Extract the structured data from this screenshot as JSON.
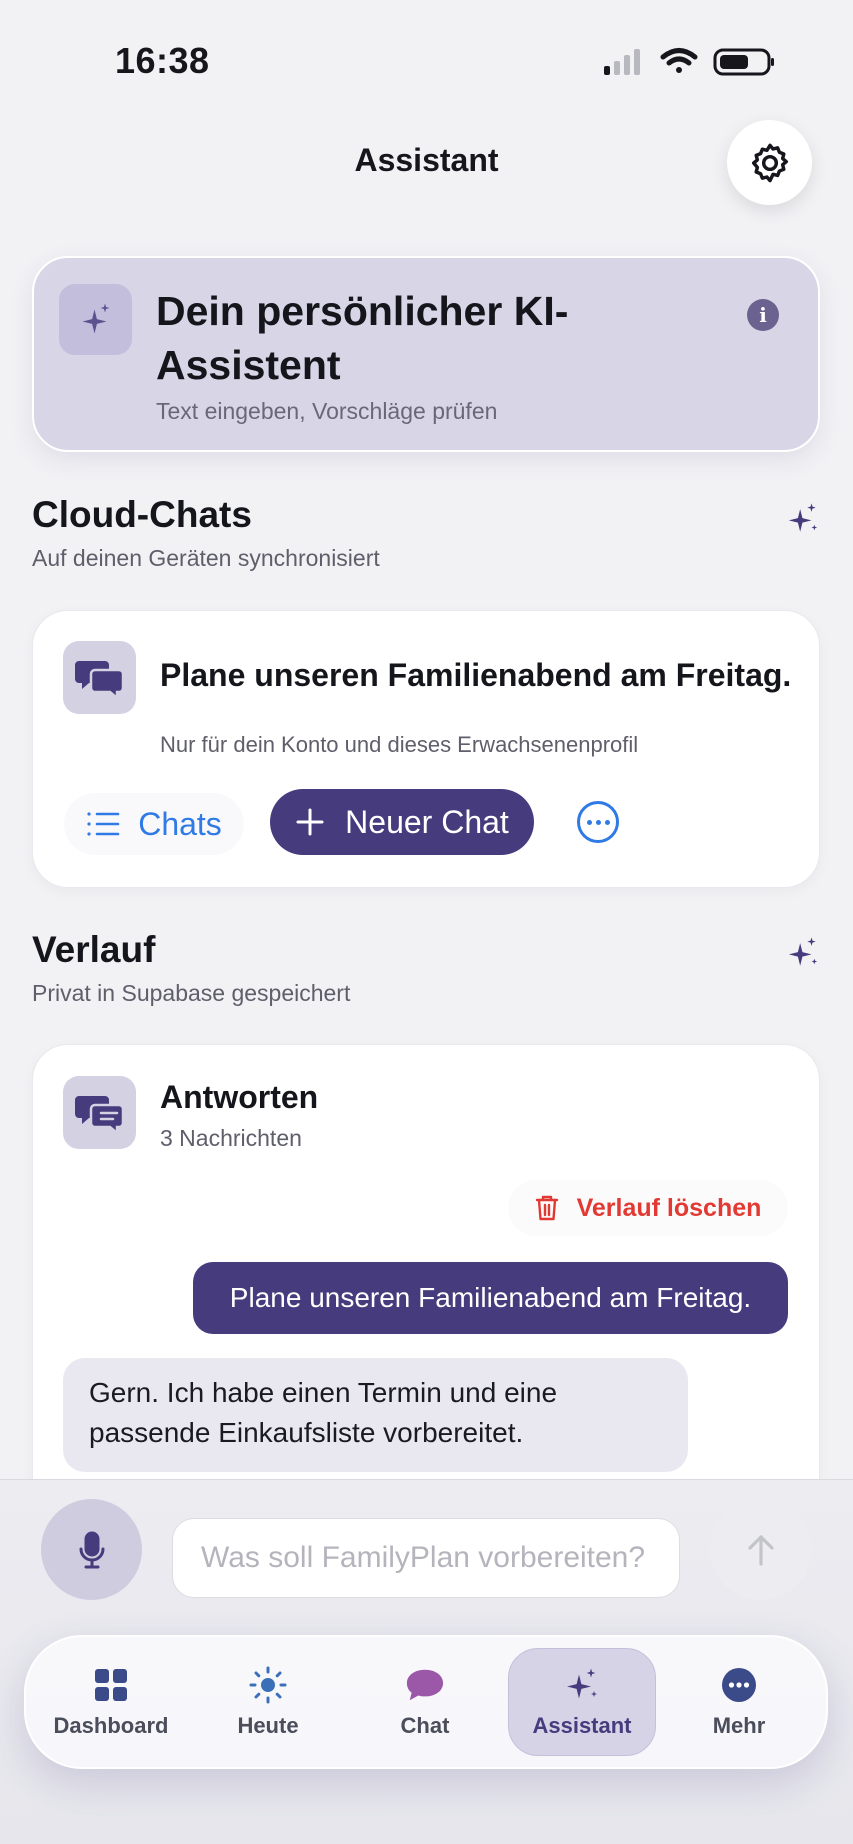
{
  "status_bar": {
    "time": "16:38"
  },
  "header": {
    "title": "Assistant"
  },
  "hero": {
    "title": "Dein persönlicher KI-Assistent",
    "subtitle": "Text eingeben, Vorschläge prüfen"
  },
  "cloud_chats": {
    "title": "Cloud-Chats",
    "subtitle": "Auf deinen Geräten synchronisiert",
    "card_title": "Plane unseren Familienabend am Freitag.",
    "card_subtitle": "Nur für dein Konto und dieses Erwachsenenprofil",
    "chats_label": "Chats",
    "new_chat_label": "Neuer Chat"
  },
  "history": {
    "title": "Verlauf",
    "subtitle": "Privat in Supabase gespeichert",
    "card_title": "Antworten",
    "count": "3 Nachrichten",
    "delete_label": "Verlauf löschen",
    "messages": [
      {
        "role": "user",
        "text": "Plane unseren Familienabend am Freitag."
      },
      {
        "role": "assistant",
        "text": "Gern. Ich habe einen Termin und eine passende Einkaufsliste vorbereitet."
      }
    ]
  },
  "composer": {
    "placeholder": "Was soll FamilyPlan vorbereiten?"
  },
  "tabbar": {
    "items": [
      {
        "label": "Dashboard",
        "icon": "grid-icon"
      },
      {
        "label": "Heute",
        "icon": "sun-icon"
      },
      {
        "label": "Chat",
        "icon": "chat-bubble-icon"
      },
      {
        "label": "Assistant",
        "icon": "sparkles-icon",
        "active": true
      },
      {
        "label": "Mehr",
        "icon": "more-icon"
      }
    ]
  },
  "colors": {
    "accent": "#463b7d",
    "link": "#2f7ae5",
    "danger": "#e23a33",
    "background": "#f2f2f5"
  }
}
